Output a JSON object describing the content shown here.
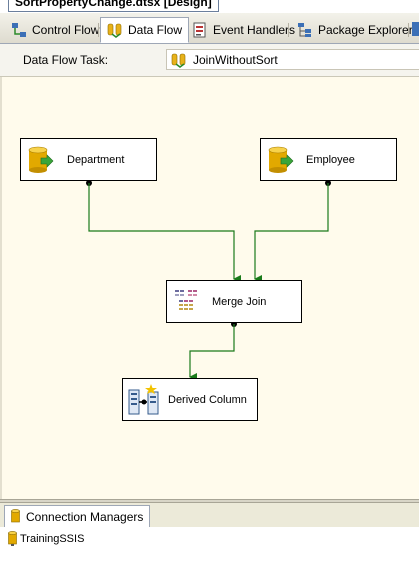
{
  "document": {
    "title": "SortPropertyChange.dtsx [Design]"
  },
  "tabs": [
    {
      "label": "Control Flow",
      "icon": "control-flow-icon",
      "active": false
    },
    {
      "label": "Data Flow",
      "icon": "data-flow-icon",
      "active": true
    },
    {
      "label": "Event Handlers",
      "icon": "event-handlers-icon",
      "active": false
    },
    {
      "label": "Package Explorer",
      "icon": "package-explorer-icon",
      "active": false
    }
  ],
  "task_bar": {
    "label": "Data Flow Task:",
    "selected": "JoinWithoutSort"
  },
  "components": [
    {
      "label": "Department",
      "icon": "ole-db-source-icon"
    },
    {
      "label": "Employee",
      "icon": "ole-db-source-icon"
    },
    {
      "label": "Merge Join",
      "icon": "merge-join-icon"
    },
    {
      "label": "Derived Column",
      "icon": "derived-column-icon"
    }
  ],
  "connection_managers": {
    "tab_label": "Connection Managers",
    "items": [
      {
        "label": "TrainingSSIS",
        "icon": "connection-manager-icon"
      }
    ]
  },
  "colors": {
    "path_green": "#1a7a1a",
    "canvas": "#fffbec",
    "tab_strip": "#e7e5da"
  }
}
